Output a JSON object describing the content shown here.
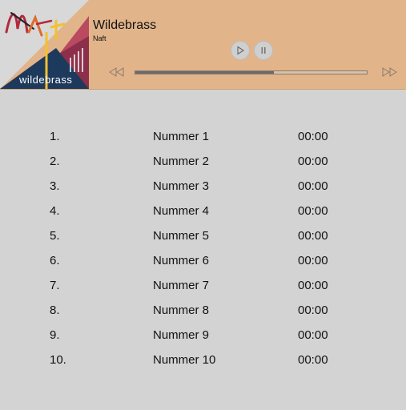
{
  "player": {
    "title": "Wildebrass",
    "artist": "Naft",
    "progress": 0.6,
    "cover": {
      "word": "wildebrass",
      "logo_text": "NAFT",
      "colors": {
        "bg_light": "#d8d8d8",
        "bg_peach": "#e2b48a",
        "navy": "#1d3a5c",
        "maroon": "#8c2f4a",
        "rose": "#b94a5f",
        "orange": "#e06a2a",
        "yellow": "#f2c12e"
      }
    }
  },
  "tracks": [
    {
      "num": "1.",
      "name": "Nummer 1",
      "time": "00:00"
    },
    {
      "num": "2.",
      "name": "Nummer 2",
      "time": "00:00"
    },
    {
      "num": "3.",
      "name": "Nummer 3",
      "time": "00:00"
    },
    {
      "num": "4.",
      "name": "Nummer 4",
      "time": "00:00"
    },
    {
      "num": "5.",
      "name": "Nummer 5",
      "time": "00:00"
    },
    {
      "num": "6.",
      "name": "Nummer 6",
      "time": "00:00"
    },
    {
      "num": "7.",
      "name": "Nummer 7",
      "time": "00:00"
    },
    {
      "num": "8.",
      "name": "Nummer 8",
      "time": "00:00"
    },
    {
      "num": "9.",
      "name": "Nummer 9",
      "time": "00:00"
    },
    {
      "num": "10.",
      "name": "Nummer 10",
      "time": "00:00"
    }
  ],
  "icons": {
    "play": "play-icon",
    "pause": "pause-icon",
    "rewind": "rewind-icon",
    "forward": "fast-forward-icon"
  }
}
